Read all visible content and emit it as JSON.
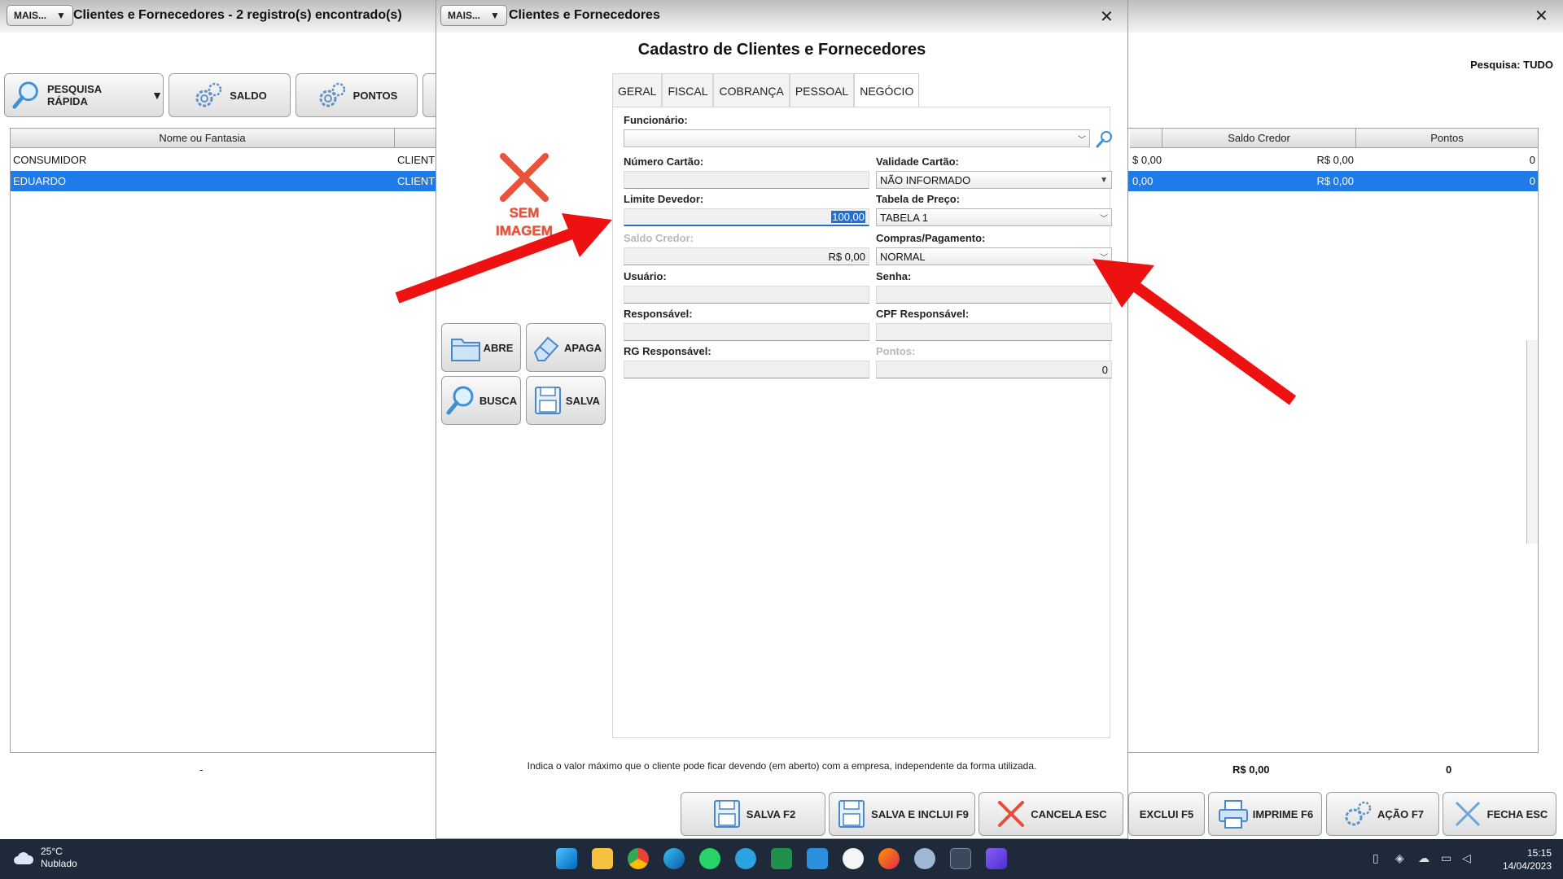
{
  "background_window": {
    "mais_label": "MAIS...",
    "title": "Clientes e Fornecedores - 2 registro(s) encontrado(s)",
    "toolbar": {
      "quick_search": "PESQUISA RÁPIDA",
      "saldo": "SALDO",
      "pontos": "PONTOS"
    },
    "search_scope": "Pesquisa: TUDO",
    "columns": {
      "name": "Nome ou Fantasia",
      "saldo_credor": "Saldo Credor",
      "pontos": "Pontos"
    },
    "rows": [
      {
        "name": "CONSUMIDOR",
        "type": "CLIENTE",
        "partial_value": "$ 0,00",
        "saldo_credor": "R$ 0,00",
        "pontos": "0"
      },
      {
        "name": "EDUARDO",
        "type": "CLIENTE",
        "partial_value": "0,00",
        "saldo_credor": "R$ 0,00",
        "pontos": "0"
      }
    ],
    "summary": {
      "dash": "-",
      "saldo_total": "R$ 0,00",
      "pontos_total": "0"
    },
    "bottom_buttons": {
      "exclui": "EXCLUI F5",
      "imprime": "IMPRIME F6",
      "acao": "AÇÃO F7",
      "fecha": "FECHA ESC"
    }
  },
  "modal": {
    "mais_label": "MAIS...",
    "title": "Clientes e Fornecedores",
    "heading": "Cadastro de Clientes e Fornecedores",
    "no_image_text_1": "SEM",
    "no_image_text_2": "IMAGEM",
    "side_buttons": {
      "abre": "ABRE",
      "apaga": "APAGA",
      "busca": "BUSCA",
      "salva": "SALVA"
    },
    "tabs": [
      {
        "label": "GERAL"
      },
      {
        "label": "FISCAL"
      },
      {
        "label": "COBRANÇA"
      },
      {
        "label": "PESSOAL"
      },
      {
        "label": "NEGÓCIO"
      }
    ],
    "form": {
      "funcionario_label": "Funcionário:",
      "funcionario_value": "",
      "numero_cartao_label": "Número Cartão:",
      "numero_cartao_value": "",
      "validade_cartao_label": "Validade Cartão:",
      "validade_cartao_value": "NÃO INFORMADO",
      "limite_devedor_label": "Limite Devedor:",
      "limite_devedor_value": "100,00",
      "tabela_preco_label": "Tabela de Preço:",
      "tabela_preco_value": "TABELA 1",
      "saldo_credor_label": "Saldo Credor:",
      "saldo_credor_value": "R$ 0,00",
      "compras_pagamento_label": "Compras/Pagamento:",
      "compras_pagamento_value": "NORMAL",
      "usuario_label": "Usuário:",
      "usuario_value": "",
      "senha_label": "Senha:",
      "senha_value": "",
      "responsavel_label": "Responsável:",
      "responsavel_value": "",
      "cpf_responsavel_label": "CPF Responsável:",
      "cpf_responsavel_value": "",
      "rg_responsavel_label": "RG Responsável:",
      "rg_responsavel_value": "",
      "pontos_label": "Pontos:",
      "pontos_value": "0"
    },
    "hint": "Indica o valor máximo que o cliente pode ficar devendo (em aberto) com a empresa, independente da forma utilizada.",
    "bottom_buttons": {
      "salva": "SALVA F2",
      "salva_inclui": "SALVA E INCLUI F9",
      "cancela": "CANCELA ESC"
    }
  },
  "taskbar": {
    "temperature": "25°C",
    "weather": "Nublado",
    "time": "15:15",
    "date": "14/04/2023"
  },
  "colors": {
    "selection": "#1e7be8",
    "annotation_arrow": "#ee1111",
    "no_image": "#e8533a",
    "taskbar": "#1e2a3a"
  }
}
